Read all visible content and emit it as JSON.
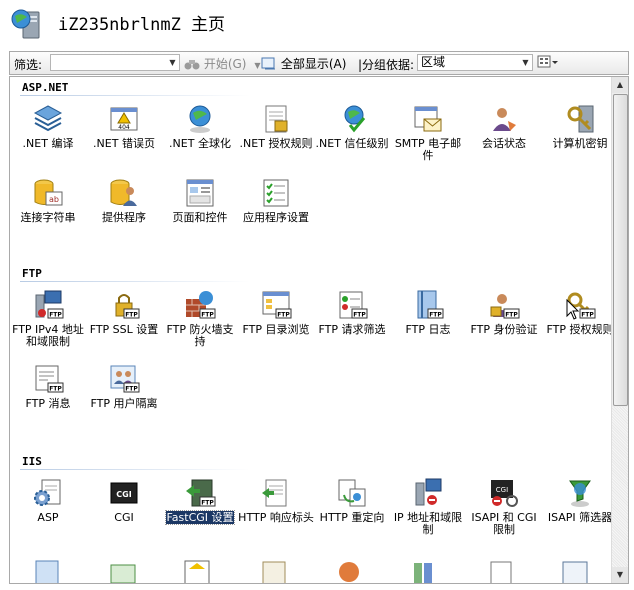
{
  "header": {
    "title": "iZ235nbrlnmZ 主页"
  },
  "toolbar": {
    "filter_label": "筛选:",
    "start_label": "开始(G)",
    "show_all_label": "全部显示(A)",
    "group_by_label": "|分组依据:",
    "group_by_value": "区域"
  },
  "sections": [
    {
      "title": "ASP.NET",
      "items": [
        {
          "label": ".NET 编译",
          "icon": "dotnet-compilation-icon"
        },
        {
          "label": ".NET 错误页",
          "icon": "dotnet-error-pages-icon"
        },
        {
          "label": ".NET 全球化",
          "icon": "dotnet-globalization-icon"
        },
        {
          "label": ".NET 授权规则",
          "icon": "dotnet-authorization-rules-icon"
        },
        {
          "label": ".NET 信任级别",
          "icon": "dotnet-trust-levels-icon"
        },
        {
          "label": "SMTP 电子邮件",
          "icon": "smtp-email-icon"
        },
        {
          "label": "会话状态",
          "icon": "session-state-icon"
        },
        {
          "label": "计算机密钥",
          "icon": "machine-key-icon"
        },
        {
          "label": "连接字符串",
          "icon": "connection-strings-icon"
        },
        {
          "label": "提供程序",
          "icon": "providers-icon"
        },
        {
          "label": "页面和控件",
          "icon": "pages-controls-icon"
        },
        {
          "label": "应用程序设置",
          "icon": "application-settings-icon"
        }
      ]
    },
    {
      "title": "FTP",
      "items": [
        {
          "label": "FTP IPv4 地址和域限制",
          "icon": "ftp-ip-restrictions-icon"
        },
        {
          "label": "FTP SSL 设置",
          "icon": "ftp-ssl-icon"
        },
        {
          "label": "FTP 防火墙支持",
          "icon": "ftp-firewall-icon"
        },
        {
          "label": "FTP 目录浏览",
          "icon": "ftp-directory-browsing-icon"
        },
        {
          "label": "FTP 请求筛选",
          "icon": "ftp-request-filtering-icon"
        },
        {
          "label": "FTP 日志",
          "icon": "ftp-logging-icon"
        },
        {
          "label": "FTP 身份验证",
          "icon": "ftp-authentication-icon"
        },
        {
          "label": "FTP 授权规则",
          "icon": "ftp-authorization-icon"
        },
        {
          "label": "FTP 消息",
          "icon": "ftp-messages-icon"
        },
        {
          "label": "FTP 用户隔离",
          "icon": "ftp-user-isolation-icon"
        }
      ]
    },
    {
      "title": "IIS",
      "items": [
        {
          "label": "ASP",
          "icon": "asp-icon"
        },
        {
          "label": "CGI",
          "icon": "cgi-icon"
        },
        {
          "label": "FastCGI 设置",
          "icon": "fastcgi-icon"
        },
        {
          "label": "HTTP 响应标头",
          "icon": "http-response-headers-icon"
        },
        {
          "label": "HTTP 重定向",
          "icon": "http-redirect-icon"
        },
        {
          "label": "IP 地址和域限制",
          "icon": "ip-domain-restrictions-icon"
        },
        {
          "label": "ISAPI 和 CGI 限制",
          "icon": "isapi-cgi-restrictions-icon"
        },
        {
          "label": "ISAPI 筛选器",
          "icon": "isapi-filters-icon"
        }
      ]
    }
  ]
}
